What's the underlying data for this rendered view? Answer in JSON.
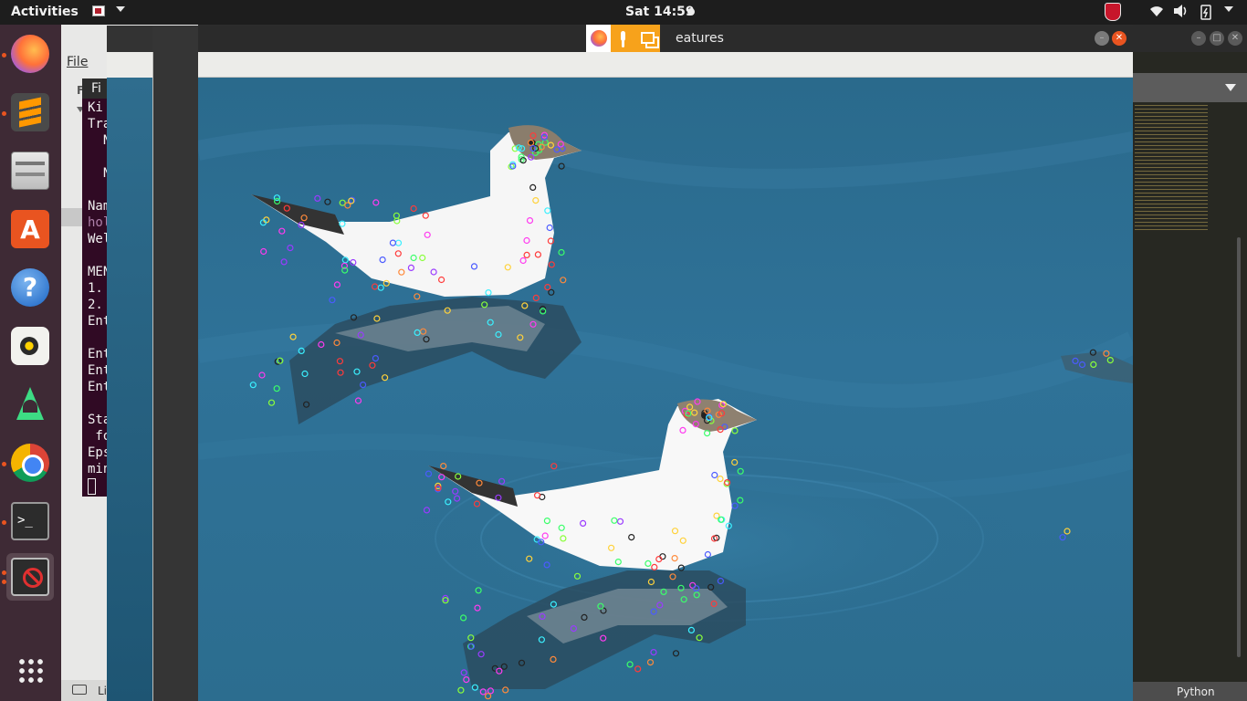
{
  "topbar": {
    "activities": "Activities",
    "clock": "Sat 14:59",
    "tray_icons": [
      "wifi-icon",
      "volume-icon",
      "battery-icon",
      "power-menu-icon"
    ]
  },
  "dock": {
    "apps": [
      {
        "name": "Firefox",
        "icon": "firefox-icon",
        "running": true
      },
      {
        "name": "Sublime Text",
        "icon": "sublime-icon",
        "running": true
      },
      {
        "name": "Files",
        "icon": "files-icon",
        "running": false
      },
      {
        "name": "Ubuntu Software",
        "icon": "software-icon",
        "glyph": "A",
        "running": false
      },
      {
        "name": "Help",
        "icon": "help-icon",
        "glyph": "?",
        "running": false
      },
      {
        "name": "Rhythmbox",
        "icon": "speaker-icon",
        "running": false
      },
      {
        "name": "Android Studio",
        "icon": "android-studio-icon",
        "running": false
      },
      {
        "name": "Google Chrome",
        "icon": "chrome-icon",
        "running": true
      },
      {
        "name": "Terminal",
        "icon": "terminal-icon",
        "glyph": ">_",
        "running": true
      },
      {
        "name": "Image window",
        "icon": "forbidden-icon",
        "running": true
      }
    ],
    "show_apps": "apps-grid-icon"
  },
  "background_app": {
    "menu_file": "File",
    "status_text": "Li",
    "terminal_lines": [
      "Ki",
      "Tra",
      "  N",
      "",
      "  N",
      "",
      "Nam",
      "hol",
      "Wel",
      "",
      "MEN",
      "1.",
      "2.",
      "Ent",
      "",
      "Ent",
      "Ent",
      "Ent",
      "",
      "Sta",
      " fo",
      "Eps",
      "min"
    ],
    "side_labels": [
      "Fi",
      "Fo"
    ]
  },
  "sublime": {
    "syntax": "Python"
  },
  "image_window": {
    "title": "eatures",
    "overlay_icons": [
      "firefox-icon",
      "microphone-icon",
      "screen-share-icon"
    ]
  },
  "colors": {
    "water": "#2f6f92",
    "terminal_bg": "#300a24",
    "accent": "#e95420",
    "dock_bg": "#3e2a35"
  }
}
